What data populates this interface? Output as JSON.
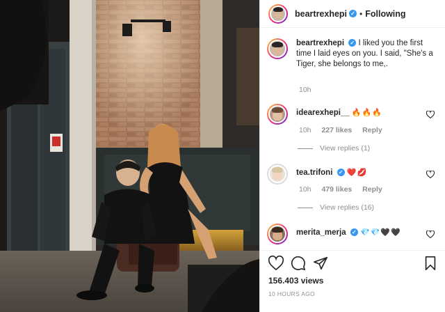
{
  "post": {
    "username": "beartrexhepi",
    "follow_status": "Following",
    "dot": "•",
    "verified_mark": "✓"
  },
  "caption": {
    "username": "beartrexhepi",
    "text": "I liked you the first time I laid eyes on you. I said, \"She's a Tiger, she belongs to me,.",
    "time": "10h"
  },
  "comments": [
    {
      "username": "idearexhepi__",
      "emojis": "🔥🔥🔥",
      "time": "10h",
      "likes": "227 likes",
      "reply": "Reply",
      "view_replies": "View replies (1)"
    },
    {
      "username": "tea.trifoni",
      "emojis": "❤️💋",
      "time": "10h",
      "likes": "479 likes",
      "reply": "Reply",
      "view_replies": "View replies (16)"
    },
    {
      "username": "merita_merja",
      "emojis": "💎💎🖤🖤",
      "time": "",
      "likes": "",
      "reply": "",
      "view_replies": ""
    }
  ],
  "stats": {
    "views": "156.403 views",
    "posted": "10 HOURS AGO"
  },
  "icons": {
    "like": "heart-outline-icon",
    "comment": "comment-bubble-icon",
    "share": "paper-plane-icon",
    "save": "bookmark-icon",
    "comment_like": "heart-outline-icon"
  },
  "colors": {
    "verified_blue": "#3897f0",
    "muted_text": "#8e8e8e",
    "primary_text": "#262626",
    "divider": "#efefef"
  }
}
